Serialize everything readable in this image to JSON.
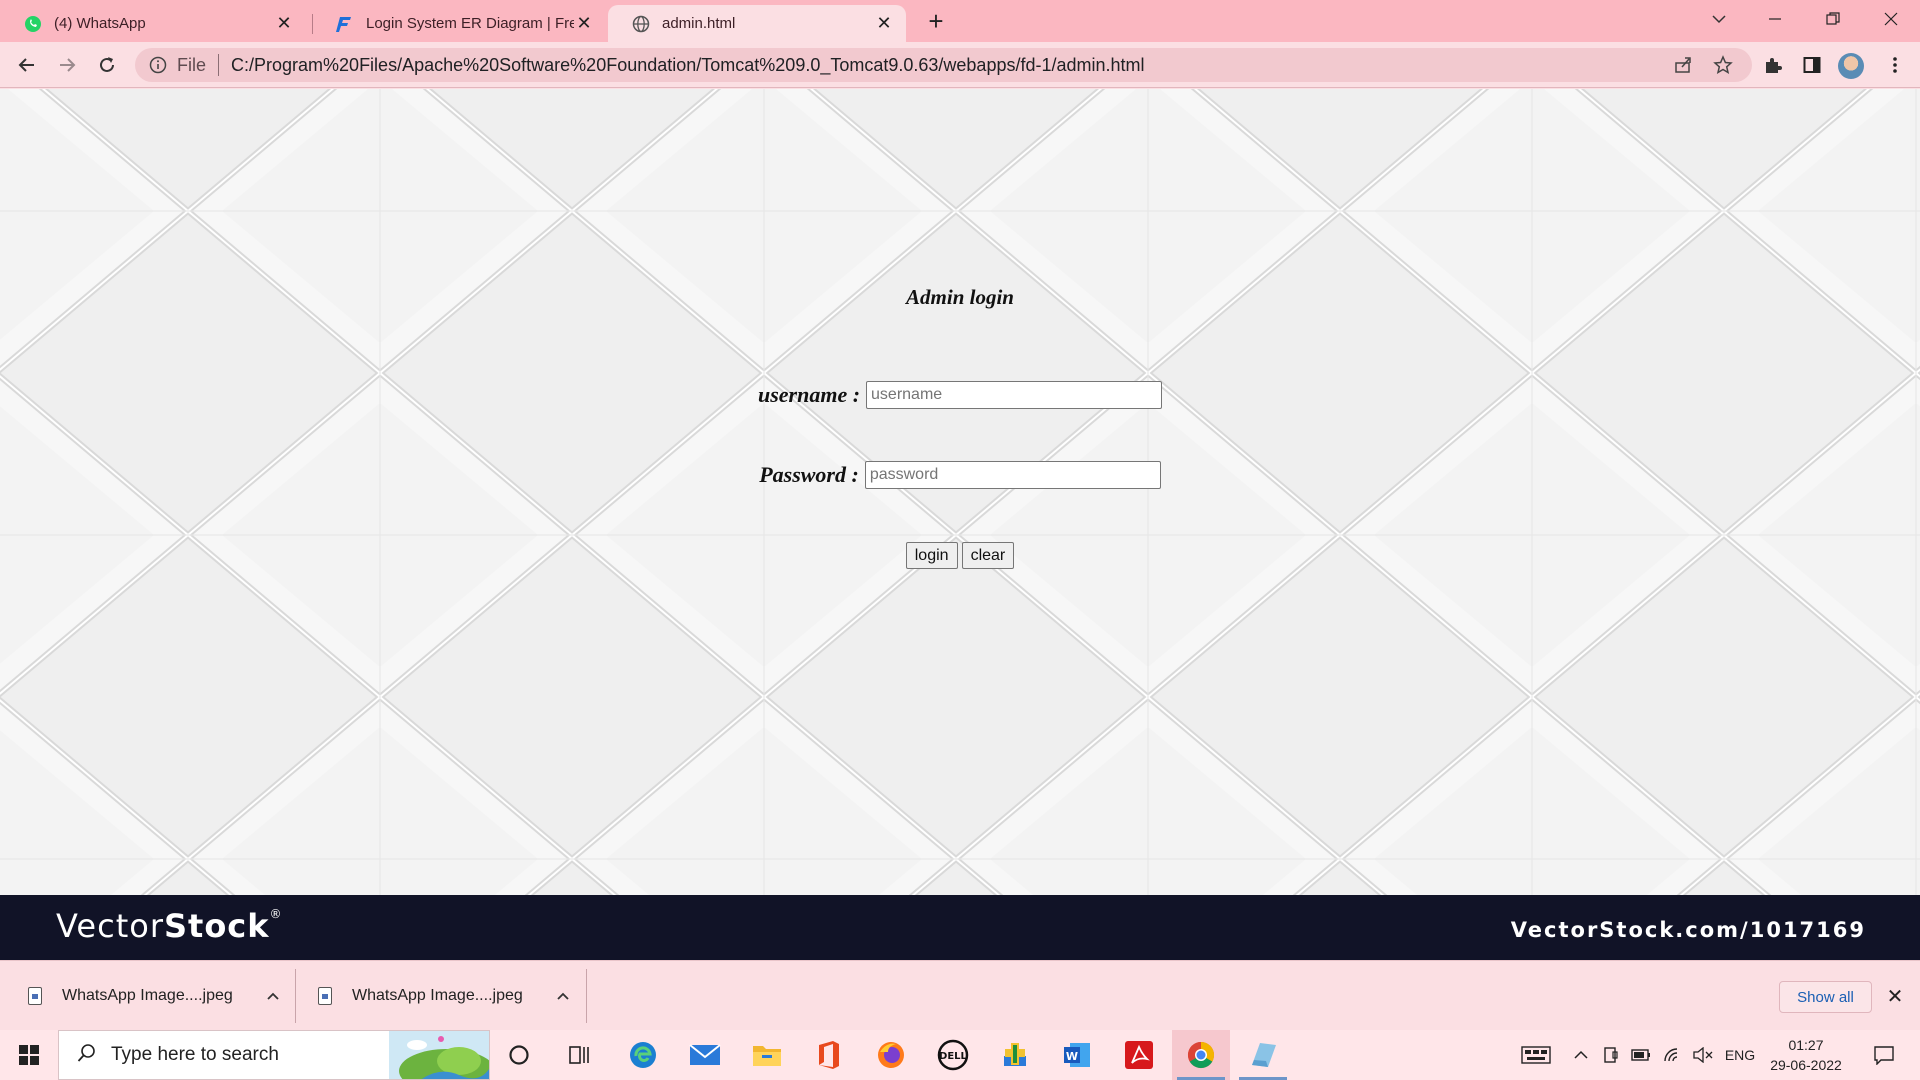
{
  "browser": {
    "tabs": [
      {
        "title": "(4) WhatsApp",
        "icon": "whatsapp-icon",
        "active": false
      },
      {
        "title": "Login System ER Diagram | FreeP",
        "icon": "freeprojectz-icon",
        "active": false
      },
      {
        "title": "admin.html",
        "icon": "globe-icon",
        "active": true
      }
    ],
    "address": {
      "scheme_label": "File",
      "url": "C:/Program%20Files/Apache%20Software%20Foundation/Tomcat%209.0_Tomcat9.0.63/webapps/fd-1/admin.html"
    }
  },
  "page": {
    "heading": "Admin login",
    "username_label": "username :",
    "username_placeholder": "username",
    "password_label": "Password :",
    "password_placeholder": "password",
    "login_button": "login",
    "clear_button": "clear",
    "watermark": {
      "brand_thin": "Vector",
      "brand_bold": "Stock",
      "registered": "®",
      "url": "VectorStock.com/1017169"
    }
  },
  "downloads": {
    "items": [
      {
        "name": "WhatsApp Image....jpeg"
      },
      {
        "name": "WhatsApp Image....jpeg"
      }
    ],
    "show_all": "Show all"
  },
  "taskbar": {
    "search_placeholder": "Type here to search",
    "language": "ENG",
    "time": "01:27",
    "date": "29-06-2022"
  },
  "colors": {
    "tabstrip": "#fbb7c1",
    "toolbar": "#fbdfe3",
    "banner": "#111327",
    "link": "#1a5fb4"
  }
}
